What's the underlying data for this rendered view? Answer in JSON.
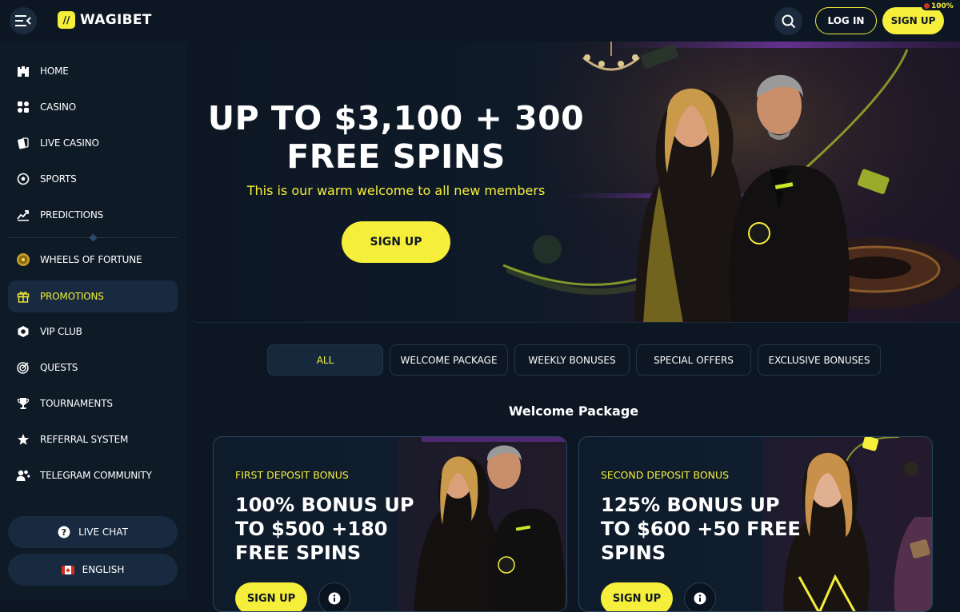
{
  "brand": {
    "name": "WAGIBET"
  },
  "header": {
    "login_label": "LOG IN",
    "signup_label": "SIGN UP",
    "signup_badge": "100%"
  },
  "sidebar": {
    "items": [
      {
        "label": "HOME",
        "icon": "castle-icon"
      },
      {
        "label": "CASINO",
        "icon": "casino-icon"
      },
      {
        "label": "LIVE CASINO",
        "icon": "cards-icon"
      },
      {
        "label": "SPORTS",
        "icon": "soccer-ball-icon"
      },
      {
        "label": "PREDICTIONS",
        "icon": "chart-icon"
      },
      {
        "label": "WHEELS OF FORTUNE",
        "icon": "wheel-icon"
      },
      {
        "label": "PROMOTIONS",
        "icon": "gift-icon",
        "active": true
      },
      {
        "label": "VIP CLUB",
        "icon": "vip-icon"
      },
      {
        "label": "QUESTS",
        "icon": "target-icon"
      },
      {
        "label": "TOURNAMENTS",
        "icon": "trophy-icon"
      },
      {
        "label": "REFERRAL SYSTEM",
        "icon": "star-icon"
      },
      {
        "label": "TELEGRAM COMMUNITY",
        "icon": "users-icon"
      }
    ],
    "live_chat_label": "LIVE CHAT",
    "language_label": "ENGLISH"
  },
  "hero": {
    "title_line1": "UP TO $3,100 + 300",
    "title_line2": "FREE SPINS",
    "subtitle": "This is our warm welcome to all new members",
    "cta_label": "SIGN UP"
  },
  "tabs": [
    {
      "label": "ALL",
      "active": true
    },
    {
      "label": "WELCOME PACKAGE"
    },
    {
      "label": "WEEKLY BONUSES"
    },
    {
      "label": "SPECIAL OFFERS"
    },
    {
      "label": "EXCLUSIVE BONUSES"
    }
  ],
  "section_title": "Welcome Package",
  "cards": [
    {
      "kicker": "FIRST DEPOSIT BONUS",
      "title": "100% BONUS UP TO $500 +180 FREE SPINS",
      "cta_label": "SIGN UP"
    },
    {
      "kicker": "SECOND DEPOSIT BONUS",
      "title": "125% BONUS UP TO $600 +50 FREE SPINS",
      "cta_label": "SIGN UP"
    }
  ],
  "colors": {
    "accent": "#f5ee3a",
    "background": "#0d1724",
    "sidebar": "#0f1a27",
    "active_item": "#172a3f"
  }
}
